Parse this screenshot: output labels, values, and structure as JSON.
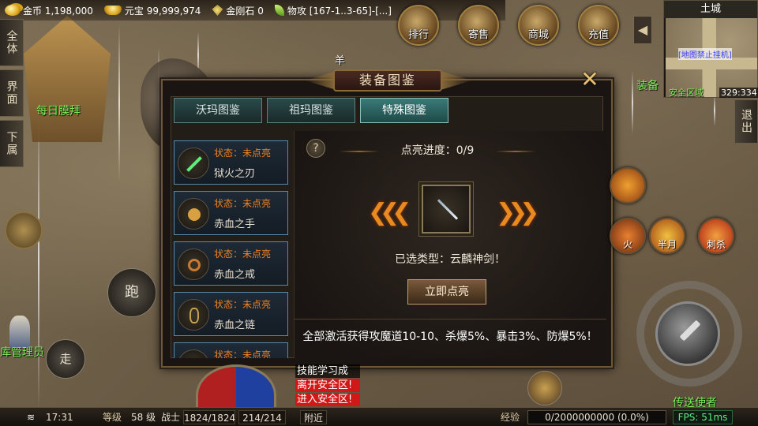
{
  "topbar": {
    "gold_label": "金币 1,198,000",
    "yuanbao_label": "元宝 99,999,974",
    "diamond_label": "金刚石 0",
    "items_label": "物攻 [167-1..3-65]-[...]"
  },
  "sidetabs": [
    "全体",
    "界面",
    "下属"
  ],
  "top_icons": [
    "排行",
    "寄售",
    "商城",
    "充值"
  ],
  "minimap": {
    "title": "土城",
    "notice": "[地图禁止挂机]",
    "safe_zone": "安全区域",
    "coords": "329:334"
  },
  "world": {
    "npc_worship": "每日膜拜",
    "npc_sheep": "羊",
    "npc_warehouse": "库管理员",
    "npc_equip": "装备",
    "npc_messenger": "传送使者",
    "run_label": "跑",
    "walk_label": "走",
    "exit_label": "退出"
  },
  "dialog": {
    "title": "装备图鉴",
    "tabs": [
      "沃玛图鉴",
      "祖玛图鉴",
      "特殊图鉴"
    ],
    "active_tab": 2,
    "items": [
      {
        "status": "状态：未点亮",
        "name": "狱火之刃"
      },
      {
        "status": "状态：未点亮",
        "name": "赤血之手"
      },
      {
        "status": "状态：未点亮",
        "name": "赤血之戒"
      },
      {
        "status": "状态：未点亮",
        "name": "赤血之链"
      },
      {
        "status": "状态：未点亮",
        "name": ""
      }
    ],
    "progress": "点亮进度：0/9",
    "selected": "已选类型：云麟神剑！",
    "light_button": "立即点亮",
    "bonus": "全部激活获得攻魔道10-10、杀爆5%、暴击3%、防爆5%！",
    "help": "?"
  },
  "skills": [
    "火",
    "半月",
    "刺杀"
  ],
  "messages": [
    "技能学习成功！",
    "离开安全区!",
    "进入安全区!"
  ],
  "bottom": {
    "time": "17:31",
    "level_label": "等级",
    "level": "58 级",
    "class": "战士",
    "hp": "1824/1824",
    "mp": "214/214",
    "nearby": "附近",
    "exp_label": "经验",
    "exp": "0/2000000000 (0.0%)",
    "fps": "FPS: 51ms"
  },
  "colors": {
    "accent": "#e88a20",
    "status": "#f08020",
    "tab_active": "#3a7a78",
    "fps": "#5af07a"
  }
}
